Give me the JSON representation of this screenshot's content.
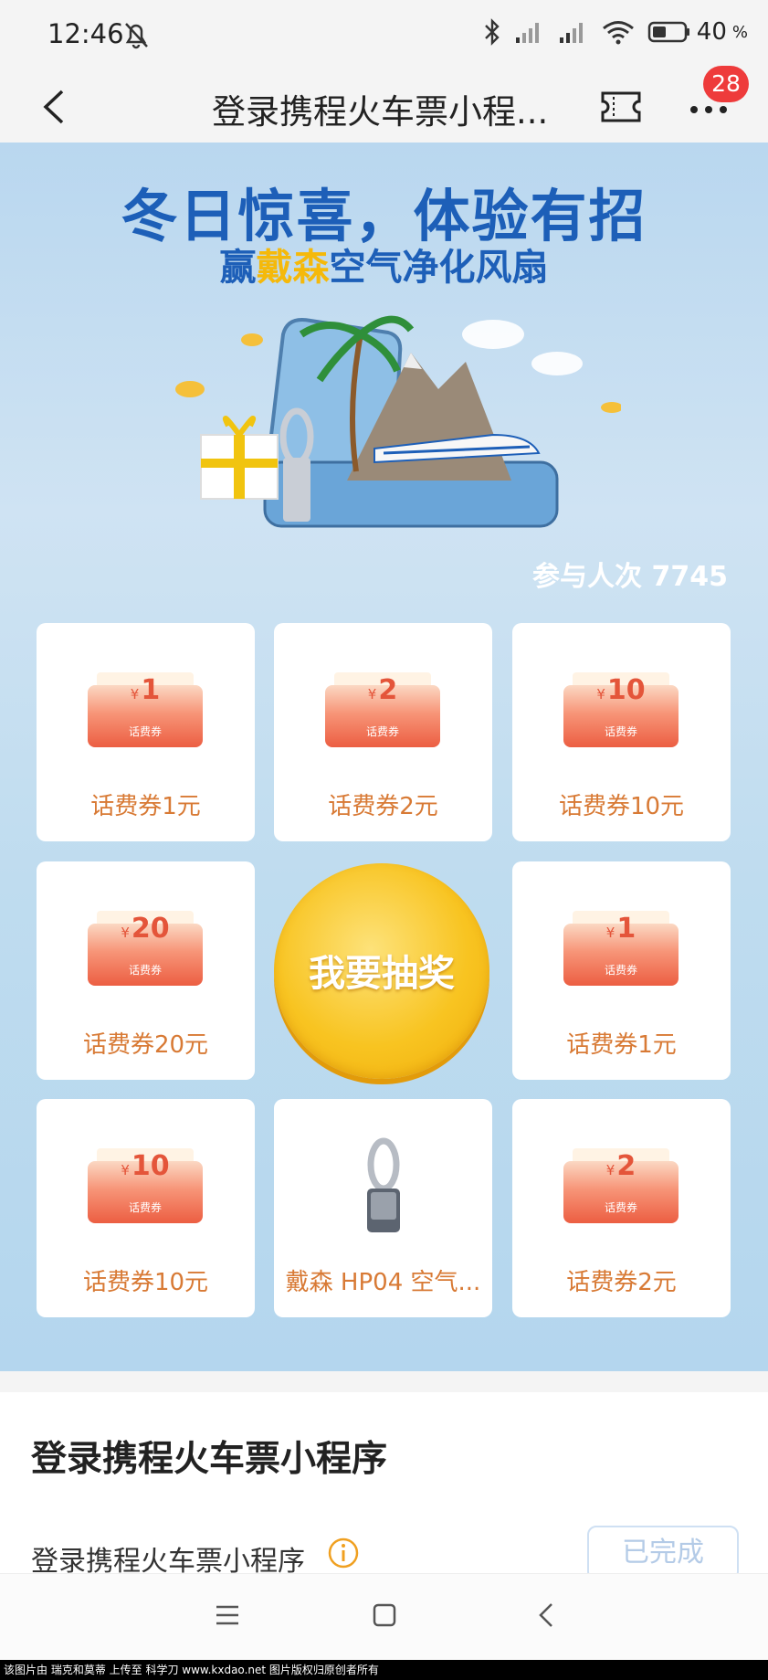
{
  "status_bar": {
    "time": "12:46",
    "battery": "40",
    "battery_unit": "%"
  },
  "nav": {
    "title": "登录携程火车票小程...",
    "badge_count": "28"
  },
  "banner": {
    "headline": "冬日惊喜，体验有招",
    "sub_prefix": "赢",
    "sub_highlight": "戴森",
    "sub_suffix": "空气净化风扇",
    "participants": "参与人次 7745"
  },
  "prizes": [
    {
      "amount": "1",
      "currency": "¥",
      "tag": "话费券",
      "label": "话费券1元"
    },
    {
      "amount": "2",
      "currency": "¥",
      "tag": "话费券",
      "label": "话费券2元"
    },
    {
      "amount": "10",
      "currency": "¥",
      "tag": "话费券",
      "label": "话费券10元"
    },
    {
      "amount": "20",
      "currency": "¥",
      "tag": "话费券",
      "label": "话费券20元"
    },
    {
      "amount": "1",
      "currency": "¥",
      "tag": "话费券",
      "label": "话费券1元"
    },
    {
      "amount": "10",
      "currency": "¥",
      "tag": "话费券",
      "label": "话费券10元"
    },
    {
      "label": "戴森 HP04 空气..."
    },
    {
      "amount": "2",
      "currency": "¥",
      "tag": "话费券",
      "label": "话费券2元"
    }
  ],
  "draw_button": "我要抽奖",
  "task": {
    "heading": "登录携程火车票小程序",
    "row_label": "登录携程火车票小程序",
    "status_button": "已完成"
  },
  "footer": "该图片由 瑞克和莫蒂 上传至 科学刀 www.kxdao.net 图片版权归原创者所有",
  "colors": {
    "accent_blue": "#1d5fb8",
    "prize_text": "#d87a35",
    "badge_red": "#ee3b3b",
    "draw_gold": "#f8c421"
  }
}
